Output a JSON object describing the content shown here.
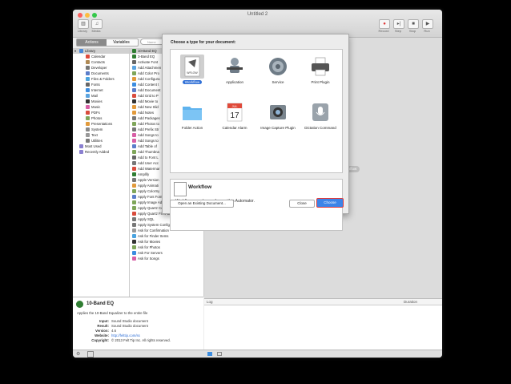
{
  "window": {
    "title": "Untitled 2",
    "toolbar_left": [
      {
        "label": "Library"
      },
      {
        "label": "Media"
      }
    ],
    "toolbar_right": [
      {
        "label": "Record"
      },
      {
        "label": "Step"
      },
      {
        "label": "Stop"
      },
      {
        "label": "Run"
      }
    ]
  },
  "tabs": {
    "actions": "Actions",
    "variables": "Variables"
  },
  "search": {
    "placeholder": "Name"
  },
  "library": [
    {
      "label": "Library",
      "color": "#4b8ad8"
    },
    {
      "label": "Calendar",
      "color": "#e04a3a"
    },
    {
      "label": "Contacts",
      "color": "#b08a55"
    },
    {
      "label": "Developer",
      "color": "#777777"
    },
    {
      "label": "Documents",
      "color": "#5b7dc9"
    },
    {
      "label": "Files & Folders",
      "color": "#4aa3df"
    },
    {
      "label": "Fonts",
      "color": "#666666"
    },
    {
      "label": "Internet",
      "color": "#3c8de0"
    },
    {
      "label": "Mail",
      "color": "#5ba4e0"
    },
    {
      "label": "Movies",
      "color": "#333333"
    },
    {
      "label": "Music",
      "color": "#d85fa6"
    },
    {
      "label": "PDFs",
      "color": "#d94c3d"
    },
    {
      "label": "Photos",
      "color": "#7fa65a"
    },
    {
      "label": "Presentations",
      "color": "#e29a3b"
    },
    {
      "label": "System",
      "color": "#888888"
    },
    {
      "label": "Text",
      "color": "#999999"
    },
    {
      "label": "Utilities",
      "color": "#7a7a7a"
    },
    {
      "label": "Most Used",
      "color": "#8a7fd0"
    },
    {
      "label": "Recently Added",
      "color": "#8a7fd0"
    }
  ],
  "actions": [
    {
      "label": "10-Band EQ",
      "color": "#2f7d32"
    },
    {
      "label": "3-Band EQ",
      "color": "#2f7d32"
    },
    {
      "label": "Activate Font",
      "color": "#666666"
    },
    {
      "label": "Add Attachmen",
      "color": "#5ba4e0"
    },
    {
      "label": "Add Color Pro",
      "color": "#7fa65a"
    },
    {
      "label": "Add Configura",
      "color": "#e29a3b"
    },
    {
      "label": "Add Content t",
      "color": "#3c8de0"
    },
    {
      "label": "Add Document",
      "color": "#5b7dc9"
    },
    {
      "label": "Add Grid to P",
      "color": "#d94c3d"
    },
    {
      "label": "Add Movie to",
      "color": "#333333"
    },
    {
      "label": "Add New Slid",
      "color": "#e29a3b"
    },
    {
      "label": "Add Notes",
      "color": "#e29a3b"
    },
    {
      "label": "Add Packages",
      "color": "#777777"
    },
    {
      "label": "Add Photos to",
      "color": "#7fa65a"
    },
    {
      "label": "Add Prefix Str",
      "color": "#777777"
    },
    {
      "label": "Add Songs to",
      "color": "#d85fa6"
    },
    {
      "label": "Add Songs to",
      "color": "#d85fa6"
    },
    {
      "label": "Add Table of",
      "color": "#5b7dc9"
    },
    {
      "label": "Add Thumbna",
      "color": "#7fa65a"
    },
    {
      "label": "Add to Font L",
      "color": "#666666"
    },
    {
      "label": "Add User Acc",
      "color": "#777777"
    },
    {
      "label": "Add Watermar",
      "color": "#d94c3d"
    },
    {
      "label": "Amplify",
      "color": "#2f7d32"
    },
    {
      "label": "Apple Version",
      "color": "#777777"
    },
    {
      "label": "Apply Animati",
      "color": "#e29a3b"
    },
    {
      "label": "Apply ColorSy",
      "color": "#7fa65a"
    },
    {
      "label": "Apply Font Form...ord Documents",
      "color": "#5b7dc9"
    },
    {
      "label": "Apply Image Adjustment Preset",
      "color": "#7fa65a"
    },
    {
      "label": "Apply Quartz Co...er to Image Files",
      "color": "#7fa65a"
    },
    {
      "label": "Apply Quartz Fil...PDF Documents",
      "color": "#d94c3d"
    },
    {
      "label": "Apply SQL",
      "color": "#777777"
    },
    {
      "label": "Apply System Configuration Settings",
      "color": "#777777"
    },
    {
      "label": "Ask for Confirmation",
      "color": "#999999"
    },
    {
      "label": "Ask for Finder Items",
      "color": "#4aa3df"
    },
    {
      "label": "Ask for Movies",
      "color": "#333333"
    },
    {
      "label": "Ask for Photos",
      "color": "#7fa65a"
    },
    {
      "label": "Ask For Servers",
      "color": "#3c8de0"
    },
    {
      "label": "Ask for Songs",
      "color": "#d85fa6"
    }
  ],
  "detail": {
    "title": "10-Band EQ",
    "description": "Applies the 10-Band Equalizer to the entire file",
    "rows": [
      {
        "key": "Input:",
        "val": "Sound Studio document"
      },
      {
        "key": "Result:",
        "val": "Sound Studio document"
      },
      {
        "key": "Version:",
        "val": "4.6"
      },
      {
        "key": "Website:",
        "val": "http://felttip.com/ss"
      },
      {
        "key": "Copyright:",
        "val": "© 2013 Felt Tip Inc. All rights reserved."
      }
    ]
  },
  "canvas": {
    "hint": "r workflow"
  },
  "log": {
    "col_log": "Log",
    "col_duration": "Duration"
  },
  "sheet": {
    "title": "Choose a type for your document:",
    "types": [
      {
        "label": "Workflow",
        "selected": true
      },
      {
        "label": "Application",
        "selected": false
      },
      {
        "label": "Service",
        "selected": false
      },
      {
        "label": "Print Plugin",
        "selected": false
      },
      {
        "label": "Folder Action",
        "selected": false
      },
      {
        "label": "Calendar Alarm",
        "selected": false
      },
      {
        "label": "Image Capture Plugin",
        "selected": false
      },
      {
        "label": "Dictation Command",
        "selected": false
      }
    ],
    "icon_tags": {
      "workflow": "WFLOW",
      "calendar_month": "JUL",
      "calendar_day": "17"
    },
    "description_title": "Workflow",
    "description_text": "Workflows can be run from within Automator.",
    "open_existing": "Open an Existing Document...",
    "close": "Close",
    "choose": "Choose"
  },
  "colors": {
    "accent": "#2f6fd6",
    "highlight": "#e23a3a"
  }
}
